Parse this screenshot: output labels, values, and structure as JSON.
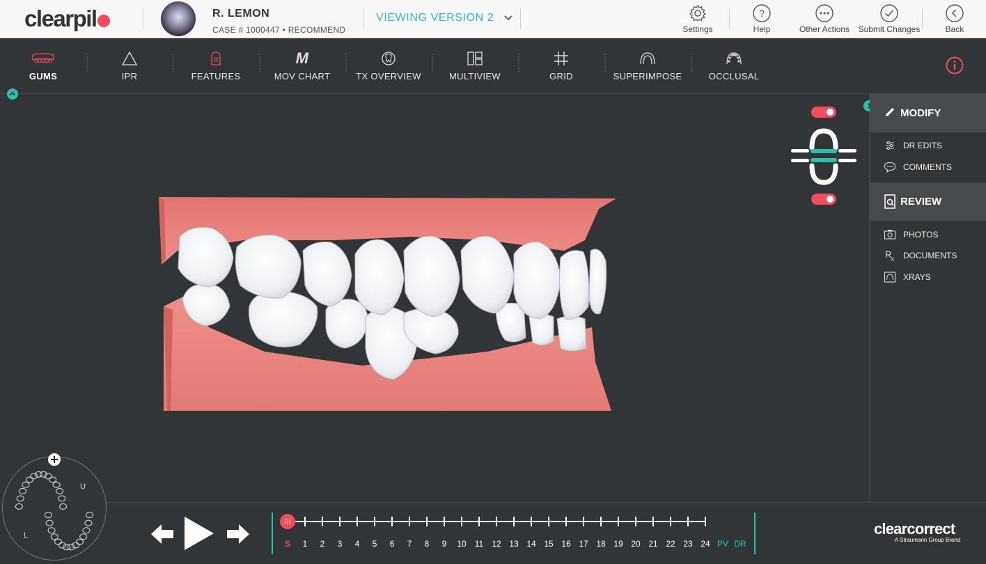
{
  "header": {
    "logo": "clearpil",
    "patient_name": "R. LEMON",
    "case_line": "CASE # 1000447 • RECOMMEND",
    "version_label": "VIEWING VERSION 2",
    "buttons": {
      "settings": "Settings",
      "help": "Help",
      "other_actions": "Other Actions",
      "submit_changes": "Submit Changes",
      "back": "Back"
    }
  },
  "toolbar": {
    "tools": [
      "GUMS",
      "IPR",
      "FEATURES",
      "MOV CHART",
      "TX OVERVIEW",
      "MULTIVIEW",
      "GRID",
      "SUPERIMPOSE",
      "OCCLUSAL"
    ],
    "active": "GUMS",
    "mov_chart_glyph": "M"
  },
  "right_panel": {
    "modify": {
      "title": "MODIFY",
      "items": [
        "DR EDITS",
        "COMMENTS"
      ]
    },
    "review": {
      "title": "REVIEW",
      "items": [
        "PHOTOS",
        "DOCUMENTS",
        "XRAYS"
      ]
    }
  },
  "viewer": {
    "upper_toggle_on": true,
    "lower_toggle_on": true
  },
  "minimap": {
    "upper_label": "U",
    "lower_label": "L"
  },
  "timeline": {
    "steps": [
      "S",
      "1",
      "2",
      "3",
      "4",
      "5",
      "6",
      "7",
      "8",
      "9",
      "10",
      "11",
      "12",
      "13",
      "14",
      "15",
      "16",
      "17",
      "18",
      "19",
      "20",
      "21",
      "22",
      "23",
      "24",
      "PV",
      "DR"
    ],
    "current_step": "S"
  },
  "brand": {
    "name": "clearcorrect",
    "tagline": "A Straumann Group Brand"
  },
  "colors": {
    "accent": "#2bbfae",
    "alert": "#ee4d5d",
    "gum": "#e8827c",
    "tooth": "#f2f2f4",
    "background": "#323537"
  }
}
